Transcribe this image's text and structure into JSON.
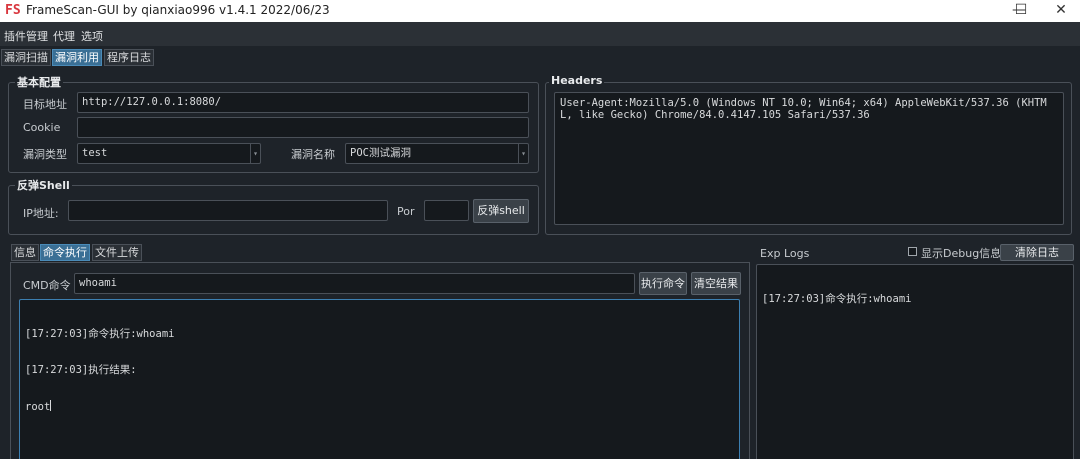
{
  "window": {
    "logo": "FS",
    "title": "FrameScan-GUI  by qianxiao996 v1.4.1 2022/06/23",
    "minimize": "—",
    "maximize": "☐",
    "close": "✕"
  },
  "menu": [
    "插件管理",
    "代理",
    "选项"
  ],
  "top_tabs": [
    {
      "label": "漏洞扫描",
      "active": false
    },
    {
      "label": "漏洞利用",
      "active": true
    },
    {
      "label": "程序日志",
      "active": false
    }
  ],
  "basic_config": {
    "title": "基本配置",
    "target_label": "目标地址",
    "target_value": "http://127.0.0.1:8080/",
    "cookie_label": "Cookie",
    "cookie_value": "",
    "vuln_type_label": "漏洞类型",
    "vuln_type_value": "test",
    "vuln_name_label": "漏洞名称",
    "vuln_name_value": "POC测试漏洞"
  },
  "headers": {
    "title": "Headers",
    "value": "User-Agent:Mozilla/5.0 (Windows NT 10.0; Win64; x64) AppleWebKit/537.36 (KHTML, like Gecko) Chrome/84.0.4147.105 Safari/537.36"
  },
  "reverse_shell": {
    "title": "反弹Shell",
    "ip_label": "IP地址:",
    "ip_value": "",
    "port_label": "Por",
    "port_value": "",
    "button": "反弹shell"
  },
  "sub_tabs": [
    {
      "label": "信息",
      "active": false
    },
    {
      "label": "命令执行",
      "active": true
    },
    {
      "label": "文件上传",
      "active": false
    }
  ],
  "cmd": {
    "label": "CMD命令",
    "value": "whoami",
    "exec_button": "执行命令",
    "clear_button": "清空结果",
    "output": [
      "[17:27:03]命令执行:whoami",
      "[17:27:03]执行结果:",
      "root"
    ]
  },
  "exp_logs": {
    "title": "Exp Logs",
    "debug_checkbox": "显示Debug信息",
    "debug_checked": false,
    "clear_button": "清除日志",
    "lines": [
      "[17:27:03]命令执行:whoami"
    ]
  }
}
